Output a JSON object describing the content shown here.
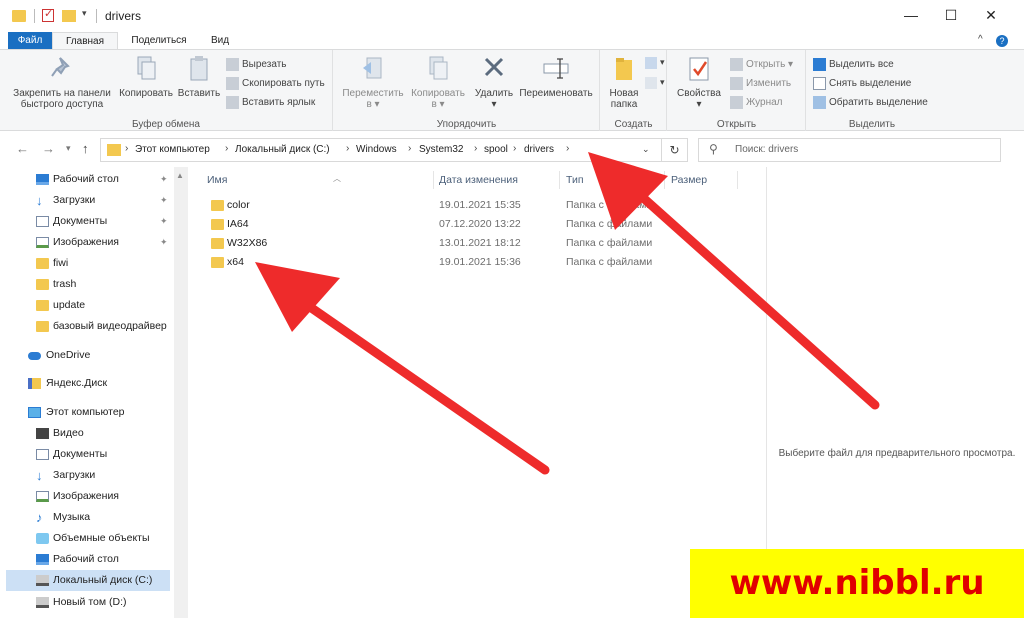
{
  "window": {
    "title": "drivers",
    "controls": {
      "minimize": "—",
      "maximize": "☐",
      "close": "✕"
    }
  },
  "tabs": {
    "file": "Файл",
    "home": "Главная",
    "share": "Поделиться",
    "view": "Вид",
    "collapse": "^",
    "help": "?"
  },
  "ribbon": {
    "clipboard": {
      "label": "Буфер обмена",
      "pin": "Закрепить на панели быстрого доступа",
      "pin_l1": "Закрепить на панели",
      "pin_l2": "быстрого доступа",
      "copy": "Копировать",
      "paste": "Вставить",
      "cut": "Вырезать",
      "copy_path": "Скопировать путь",
      "paste_shortcut": "Вставить ярлык"
    },
    "organize": {
      "label": "Упорядочить",
      "move_l1": "Переместить",
      "move_l2": "в",
      "copy_l1": "Копировать",
      "copy_l2": "в",
      "delete": "Удалить",
      "rename": "Переименовать"
    },
    "create": {
      "label": "Создать",
      "new_l1": "Новая",
      "new_l2": "папка"
    },
    "open": {
      "label": "Открыть",
      "properties": "Свойства",
      "open": "Открыть",
      "edit": "Изменить",
      "history": "Журнал"
    },
    "select": {
      "label": "Выделить",
      "select_all": "Выделить все",
      "select_none": "Снять выделение",
      "invert": "Обратить выделение"
    }
  },
  "address": {
    "crumbs": [
      "Этот компьютер",
      "Локальный диск (C:)",
      "Windows",
      "System32",
      "spool",
      "drivers"
    ],
    "search_placeholder": "Поиск: drivers"
  },
  "nav": {
    "items": [
      {
        "label": "Рабочий стол",
        "icon": "desktop-icon"
      },
      {
        "label": "Загрузки",
        "icon": "downloads-icon"
      },
      {
        "label": "Документы",
        "icon": "documents-icon"
      },
      {
        "label": "Изображения",
        "icon": "pictures-icon"
      },
      {
        "label": "fiwi",
        "icon": "folder-icon"
      },
      {
        "label": "trash",
        "icon": "folder-icon"
      },
      {
        "label": "update",
        "icon": "folder-icon"
      },
      {
        "label": "базовый видеодрайвер",
        "icon": "folder-icon"
      },
      {
        "label": "OneDrive",
        "icon": "onedrive-icon"
      },
      {
        "label": "Яндекс.Диск",
        "icon": "yandex-disk-icon"
      },
      {
        "label": "Этот компьютер",
        "icon": "this-pc-icon"
      },
      {
        "label": "Видео",
        "icon": "video-icon"
      },
      {
        "label": "Документы",
        "icon": "documents-icon"
      },
      {
        "label": "Загрузки",
        "icon": "downloads-icon"
      },
      {
        "label": "Изображения",
        "icon": "pictures-icon"
      },
      {
        "label": "Музыка",
        "icon": "music-icon"
      },
      {
        "label": "Объемные объекты",
        "icon": "3d-objects-icon"
      },
      {
        "label": "Рабочий стол",
        "icon": "desktop-icon"
      },
      {
        "label": "Локальный диск (C:)",
        "icon": "drive-icon"
      },
      {
        "label": "Новый том (D:)",
        "icon": "drive-icon"
      }
    ],
    "selected": "Локальный диск (C:)"
  },
  "columns": {
    "name": "Имя",
    "date": "Дата изменения",
    "type": "Тип",
    "size": "Размер"
  },
  "files": [
    {
      "name": "color",
      "date": "19.01.2021 15:35",
      "type": "Папка с файлами"
    },
    {
      "name": "IA64",
      "date": "07.12.2020 13:22",
      "type": "Папка с файлами"
    },
    {
      "name": "W32X86",
      "date": "13.01.2021 18:12",
      "type": "Папка с файлами"
    },
    {
      "name": "x64",
      "date": "19.01.2021 15:36",
      "type": "Папка с файлами"
    }
  ],
  "preview": {
    "text": "Выберите файл для предварительного просмотра."
  },
  "watermark": "www.nibbl.ru",
  "colors": {
    "accent": "#1a6fc2",
    "arrow": "#ee2b2b",
    "watermark_bg": "#ffff00",
    "watermark_text": "#e00000"
  }
}
